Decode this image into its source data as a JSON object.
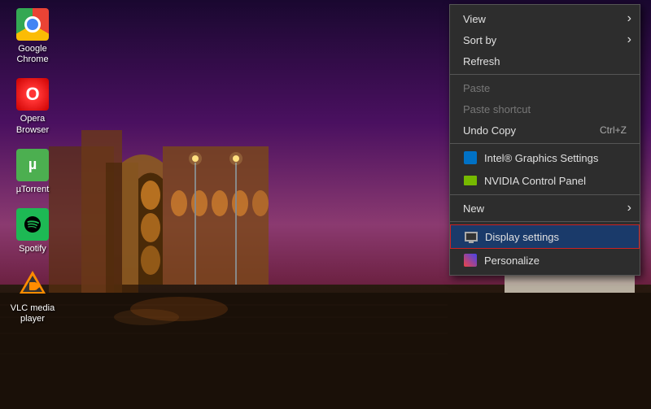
{
  "desktop": {
    "icons": [
      {
        "id": "chrome",
        "label": "Google\nChrome",
        "type": "chrome"
      },
      {
        "id": "opera",
        "label": "Opera\nBrowser",
        "type": "opera"
      },
      {
        "id": "utorrent",
        "label": "µTorrent",
        "type": "utorrent"
      },
      {
        "id": "spotify",
        "label": "Spotify",
        "type": "spotify"
      },
      {
        "id": "vlc",
        "label": "VLC media\nplayer",
        "type": "vlc"
      }
    ]
  },
  "context_menu": {
    "items": [
      {
        "id": "view",
        "label": "View",
        "hasSubmenu": true,
        "disabled": false,
        "icon": null,
        "shortcut": null
      },
      {
        "id": "sort-by",
        "label": "Sort by",
        "hasSubmenu": true,
        "disabled": false,
        "icon": null,
        "shortcut": null
      },
      {
        "id": "refresh",
        "label": "Refresh",
        "hasSubmenu": false,
        "disabled": false,
        "icon": null,
        "shortcut": null
      },
      {
        "id": "sep1",
        "type": "separator"
      },
      {
        "id": "paste",
        "label": "Paste",
        "hasSubmenu": false,
        "disabled": true,
        "icon": null,
        "shortcut": null
      },
      {
        "id": "paste-shortcut",
        "label": "Paste shortcut",
        "hasSubmenu": false,
        "disabled": true,
        "icon": null,
        "shortcut": null
      },
      {
        "id": "undo-copy",
        "label": "Undo Copy",
        "hasSubmenu": false,
        "disabled": false,
        "icon": null,
        "shortcut": "Ctrl+Z"
      },
      {
        "id": "sep2",
        "type": "separator"
      },
      {
        "id": "intel-settings",
        "label": "Intel® Graphics Settings",
        "hasSubmenu": false,
        "disabled": false,
        "icon": "intel",
        "shortcut": null
      },
      {
        "id": "nvidia-panel",
        "label": "NVIDIA Control Panel",
        "hasSubmenu": false,
        "disabled": false,
        "icon": "nvidia",
        "shortcut": null
      },
      {
        "id": "sep3",
        "type": "separator"
      },
      {
        "id": "new",
        "label": "New",
        "hasSubmenu": true,
        "disabled": false,
        "icon": null,
        "shortcut": null
      },
      {
        "id": "sep4",
        "type": "separator"
      },
      {
        "id": "display-settings",
        "label": "Display settings",
        "hasSubmenu": false,
        "disabled": false,
        "icon": "display",
        "highlighted": true,
        "shortcut": null
      },
      {
        "id": "personalize",
        "label": "Personalize",
        "hasSubmenu": false,
        "disabled": false,
        "icon": "personalize",
        "shortcut": null
      }
    ]
  }
}
